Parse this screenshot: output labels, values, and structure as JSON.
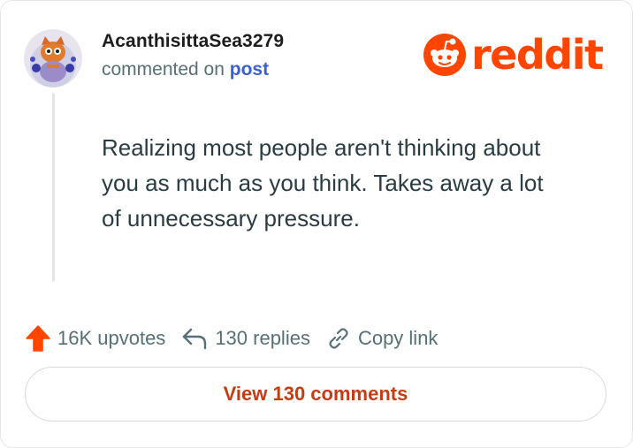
{
  "author": {
    "username": "AcanthisittaSea3279",
    "subline_prefix": "commented on",
    "subline_link": "post"
  },
  "brand": {
    "name": "reddit",
    "color": "#ff4500"
  },
  "comment": {
    "text": "Realizing most people aren't thinking about you as much as you think. Takes away a lot of unnecessary pressure."
  },
  "actions": {
    "upvotes": "16K upvotes",
    "replies": "130 replies",
    "copy_link": "Copy link"
  },
  "view_button": {
    "label": "View 130 comments"
  },
  "colors": {
    "accent": "#ff4500",
    "button_text": "#c43d12",
    "link": "#3a5fd4",
    "muted": "#576f76"
  }
}
